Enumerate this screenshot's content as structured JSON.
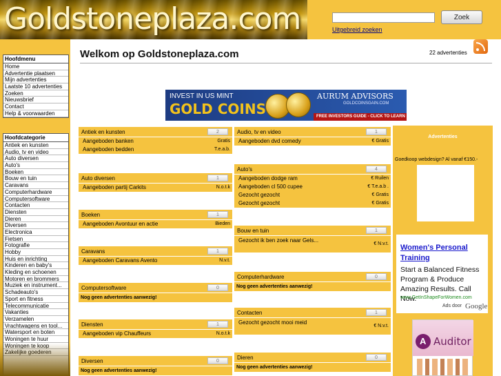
{
  "header": {
    "logo_text": "Goldstoneplaza.com",
    "search_placeholder": "",
    "search_button": "Zoek",
    "advanced_search": "Uitgebreid zoeken"
  },
  "sidebar": {
    "main_menu_title": "Hoofdmenu",
    "main_menu": [
      "Home",
      "Advertentie plaatsen",
      "Mijn advertenties",
      "Laatste 10 advertenties",
      "Zoeken",
      "Nieuwsbrief",
      "Contact",
      "Help & voorwaarden"
    ],
    "category_title": "Hoofdcategorie",
    "categories": [
      "Antiek en kunsten",
      "Audio, tv en video",
      "Auto diversen",
      "Auto's",
      "Boeken",
      "Bouw en tuin",
      "Caravans",
      "Computerhardware",
      "Computersoftware",
      "Contacten",
      "Diensten",
      "Dieren",
      "Diversen",
      "Electronica",
      "Fietsen",
      "Fotografie",
      "Hobby",
      "Huis en inrichting",
      "Kinderen en baby's",
      "Kleding en schoenen",
      "Motoren en brommers",
      "Muziek en instrument...",
      "Schadeauto's",
      "Sport en fitness",
      "Telecommunicatie",
      "Vakanties",
      "Verzamelen",
      "Vrachtwagens en tool...",
      "Watersport en boten",
      "Woningen te huur",
      "Woningen te koop",
      "Zakelijke goederen"
    ]
  },
  "main": {
    "title": "Welkom op Goldstoneplaza.com",
    "ad_count": "22 advertenties",
    "banner": {
      "line1": "INVEST IN US MINT",
      "line2": "GOLD COINS",
      "brand": "AURUM ADVISORS",
      "sub": "GOLDCOINSGAIN.COM",
      "cta": "FREE INVESTORS GUIDE - CLICK TO LEARN MORE"
    },
    "left_categories": [
      {
        "name": "Antiek en kunsten",
        "count": "2",
        "rows": [
          {
            "text": "Aangeboden banken",
            "price": "Gratis"
          },
          {
            "text": "Aangeboden bedden",
            "price": "T.e.a.b."
          }
        ]
      },
      {
        "name": "Auto diversen",
        "count": "1",
        "rows": [
          {
            "text": "Aangeboden partij Carkits",
            "price": "N.o.t.k"
          }
        ]
      },
      {
        "name": "Boeken",
        "count": "1",
        "rows": [
          {
            "text": "Aangeboden Avontuur en actie",
            "price": "Bieden"
          }
        ]
      },
      {
        "name": "Caravans",
        "count": "1",
        "rows": [
          {
            "text": "Aangeboden Caravans Avento",
            "price": "N.v.t."
          }
        ]
      },
      {
        "name": "Computersoftware",
        "count": "0",
        "empty": "Nog geen advertenties aanwezig!"
      },
      {
        "name": "Diensten",
        "count": "1",
        "rows": [
          {
            "text": "Aangeboden vip Chauffeurs",
            "price": "N.o.t.k"
          }
        ]
      },
      {
        "name": "Diversen",
        "count": "0",
        "empty": "Nog geen advertenties aanwezig!"
      }
    ],
    "mid_categories": [
      {
        "name": "Audio, tv en video",
        "count": "1",
        "rows": [
          {
            "text": "Aangeboden dvd comedy",
            "price": "€ Gratis"
          }
        ]
      },
      {
        "name": "Auto's",
        "count": "4",
        "rows": [
          {
            "text": "Aangeboden dodge ram",
            "price": "€ Ruilen"
          },
          {
            "text": "Aangeboden cl 500 cupee",
            "price": "€ T.e.a.b ."
          },
          {
            "text": "Gezocht gezocht",
            "price": "€ Gratis"
          },
          {
            "text": "Gezocht gezocht",
            "price": "€ Gratis"
          }
        ]
      },
      {
        "name": "Bouw en tuin",
        "count": "1",
        "rows": [
          {
            "text": "Gezocht ik ben zoek naar Gels...",
            "price": "€ N.v.t.",
            "tall": true
          }
        ]
      },
      {
        "name": "Computerhardware",
        "count": "0",
        "empty": "Nog geen advertenties aanwezig!"
      },
      {
        "name": "Contacten",
        "count": "1",
        "rows": [
          {
            "text": "Gezocht gezocht mooi meid",
            "price": "€ N.v.t.",
            "tall": true
          }
        ]
      },
      {
        "name": "Dieren",
        "count": "0",
        "empty": "Nog geen advertenties aanwezig!"
      }
    ]
  },
  "right": {
    "title": "Advertenties",
    "text": "Goedkoop webdesign? Al vanaf €150.-",
    "text_ad": {
      "title": "Women's Personal Training",
      "body": "Start a Balanced Fitness Program & Produce Amazing Results. Call Now.",
      "url": "www.GetInShapeForWomen.com",
      "ads_by": "Ads door",
      "google": "Google"
    },
    "auditor": "Auditor"
  },
  "colors": {
    "accent": "#f5c33f",
    "link": "#1a1acc"
  }
}
